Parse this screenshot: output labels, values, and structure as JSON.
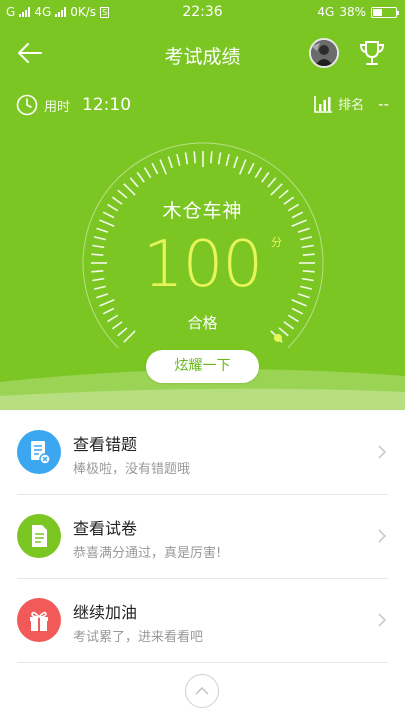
{
  "status_bar": {
    "left_text": "G",
    "network": "4G",
    "speed": "0K/s",
    "box": "S",
    "time": "22:36",
    "right_network": "4G",
    "battery": "38%",
    "battery_level": 0.38
  },
  "header": {
    "title": "考试成绩"
  },
  "stats": {
    "time_label": "用时",
    "time_value": "12:10",
    "rank_label": "排名",
    "rank_value": "--"
  },
  "result": {
    "name": "木仓车神",
    "score": "100",
    "unit": "分",
    "status": "合格",
    "share_button": "炫耀一下"
  },
  "menu": [
    {
      "title": "查看错题",
      "subtitle": "棒极啦，没有错题哦",
      "icon": "wrong-questions-icon",
      "color": "#3aa7f0"
    },
    {
      "title": "查看试卷",
      "subtitle": "恭喜满分通过，真是厉害!",
      "icon": "exam-paper-icon",
      "color": "#7cc623"
    },
    {
      "title": "继续加油",
      "subtitle": "考试累了，进来看看吧",
      "icon": "gift-icon",
      "color": "#f25a5a"
    }
  ],
  "colors": {
    "brand": "#7cc623",
    "score": "#e8f55a"
  }
}
